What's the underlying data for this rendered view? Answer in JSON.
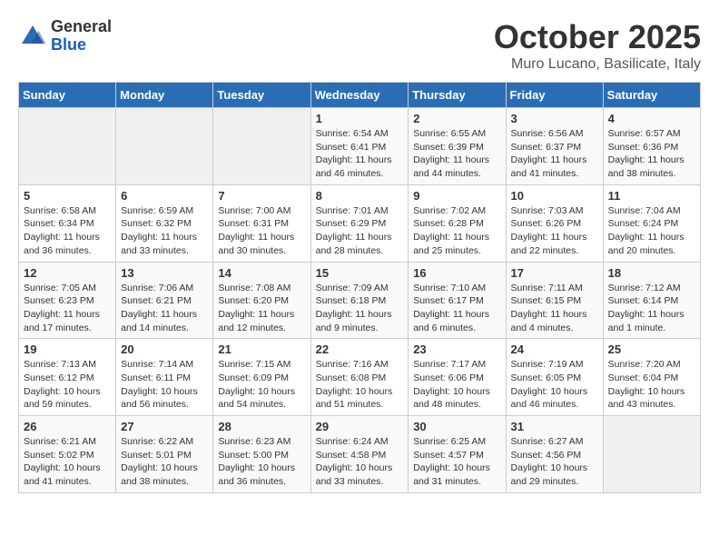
{
  "header": {
    "logo_general": "General",
    "logo_blue": "Blue",
    "month_title": "October 2025",
    "location": "Muro Lucano, Basilicate, Italy"
  },
  "weekdays": [
    "Sunday",
    "Monday",
    "Tuesday",
    "Wednesday",
    "Thursday",
    "Friday",
    "Saturday"
  ],
  "weeks": [
    [
      {
        "day": "",
        "info": ""
      },
      {
        "day": "",
        "info": ""
      },
      {
        "day": "",
        "info": ""
      },
      {
        "day": "1",
        "info": "Sunrise: 6:54 AM\nSunset: 6:41 PM\nDaylight: 11 hours\nand 46 minutes."
      },
      {
        "day": "2",
        "info": "Sunrise: 6:55 AM\nSunset: 6:39 PM\nDaylight: 11 hours\nand 44 minutes."
      },
      {
        "day": "3",
        "info": "Sunrise: 6:56 AM\nSunset: 6:37 PM\nDaylight: 11 hours\nand 41 minutes."
      },
      {
        "day": "4",
        "info": "Sunrise: 6:57 AM\nSunset: 6:36 PM\nDaylight: 11 hours\nand 38 minutes."
      }
    ],
    [
      {
        "day": "5",
        "info": "Sunrise: 6:58 AM\nSunset: 6:34 PM\nDaylight: 11 hours\nand 36 minutes."
      },
      {
        "day": "6",
        "info": "Sunrise: 6:59 AM\nSunset: 6:32 PM\nDaylight: 11 hours\nand 33 minutes."
      },
      {
        "day": "7",
        "info": "Sunrise: 7:00 AM\nSunset: 6:31 PM\nDaylight: 11 hours\nand 30 minutes."
      },
      {
        "day": "8",
        "info": "Sunrise: 7:01 AM\nSunset: 6:29 PM\nDaylight: 11 hours\nand 28 minutes."
      },
      {
        "day": "9",
        "info": "Sunrise: 7:02 AM\nSunset: 6:28 PM\nDaylight: 11 hours\nand 25 minutes."
      },
      {
        "day": "10",
        "info": "Sunrise: 7:03 AM\nSunset: 6:26 PM\nDaylight: 11 hours\nand 22 minutes."
      },
      {
        "day": "11",
        "info": "Sunrise: 7:04 AM\nSunset: 6:24 PM\nDaylight: 11 hours\nand 20 minutes."
      }
    ],
    [
      {
        "day": "12",
        "info": "Sunrise: 7:05 AM\nSunset: 6:23 PM\nDaylight: 11 hours\nand 17 minutes."
      },
      {
        "day": "13",
        "info": "Sunrise: 7:06 AM\nSunset: 6:21 PM\nDaylight: 11 hours\nand 14 minutes."
      },
      {
        "day": "14",
        "info": "Sunrise: 7:08 AM\nSunset: 6:20 PM\nDaylight: 11 hours\nand 12 minutes."
      },
      {
        "day": "15",
        "info": "Sunrise: 7:09 AM\nSunset: 6:18 PM\nDaylight: 11 hours\nand 9 minutes."
      },
      {
        "day": "16",
        "info": "Sunrise: 7:10 AM\nSunset: 6:17 PM\nDaylight: 11 hours\nand 6 minutes."
      },
      {
        "day": "17",
        "info": "Sunrise: 7:11 AM\nSunset: 6:15 PM\nDaylight: 11 hours\nand 4 minutes."
      },
      {
        "day": "18",
        "info": "Sunrise: 7:12 AM\nSunset: 6:14 PM\nDaylight: 11 hours\nand 1 minute."
      }
    ],
    [
      {
        "day": "19",
        "info": "Sunrise: 7:13 AM\nSunset: 6:12 PM\nDaylight: 10 hours\nand 59 minutes."
      },
      {
        "day": "20",
        "info": "Sunrise: 7:14 AM\nSunset: 6:11 PM\nDaylight: 10 hours\nand 56 minutes."
      },
      {
        "day": "21",
        "info": "Sunrise: 7:15 AM\nSunset: 6:09 PM\nDaylight: 10 hours\nand 54 minutes."
      },
      {
        "day": "22",
        "info": "Sunrise: 7:16 AM\nSunset: 6:08 PM\nDaylight: 10 hours\nand 51 minutes."
      },
      {
        "day": "23",
        "info": "Sunrise: 7:17 AM\nSunset: 6:06 PM\nDaylight: 10 hours\nand 48 minutes."
      },
      {
        "day": "24",
        "info": "Sunrise: 7:19 AM\nSunset: 6:05 PM\nDaylight: 10 hours\nand 46 minutes."
      },
      {
        "day": "25",
        "info": "Sunrise: 7:20 AM\nSunset: 6:04 PM\nDaylight: 10 hours\nand 43 minutes."
      }
    ],
    [
      {
        "day": "26",
        "info": "Sunrise: 6:21 AM\nSunset: 5:02 PM\nDaylight: 10 hours\nand 41 minutes."
      },
      {
        "day": "27",
        "info": "Sunrise: 6:22 AM\nSunset: 5:01 PM\nDaylight: 10 hours\nand 38 minutes."
      },
      {
        "day": "28",
        "info": "Sunrise: 6:23 AM\nSunset: 5:00 PM\nDaylight: 10 hours\nand 36 minutes."
      },
      {
        "day": "29",
        "info": "Sunrise: 6:24 AM\nSunset: 4:58 PM\nDaylight: 10 hours\nand 33 minutes."
      },
      {
        "day": "30",
        "info": "Sunrise: 6:25 AM\nSunset: 4:57 PM\nDaylight: 10 hours\nand 31 minutes."
      },
      {
        "day": "31",
        "info": "Sunrise: 6:27 AM\nSunset: 4:56 PM\nDaylight: 10 hours\nand 29 minutes."
      },
      {
        "day": "",
        "info": ""
      }
    ]
  ]
}
